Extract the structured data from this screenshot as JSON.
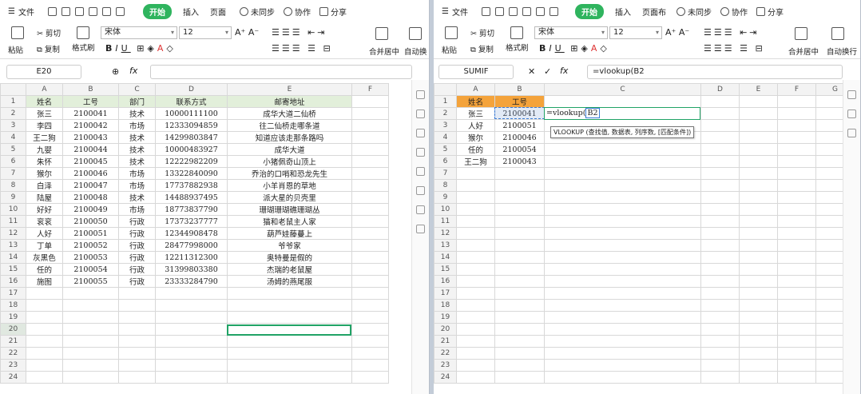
{
  "left": {
    "menu": {
      "hamburger": "☰",
      "file": "文件",
      "start": "开始",
      "insert": "插入",
      "page": "页面",
      "unsync": "未同步",
      "collab": "协作",
      "share": "分享"
    },
    "ribbon": {
      "paste": "粘贴",
      "cut": "剪切",
      "copy": "复制",
      "format_painter": "格式刷",
      "font": "宋体",
      "size": "12",
      "merge": "合并居中",
      "autowrap": "自动换"
    },
    "name_box": "E20",
    "fx": "fx",
    "formula": "",
    "columns": [
      "A",
      "B",
      "C",
      "D",
      "E",
      "F"
    ],
    "rows": [
      [
        "姓名",
        "工号",
        "部门",
        "联系方式",
        "邮寄地址",
        ""
      ],
      [
        "张三",
        "2100041",
        "技术",
        "10000111100",
        "成华大道二仙桥",
        ""
      ],
      [
        "李四",
        "2100042",
        "市场",
        "12333094859",
        "往二仙桥走哪条道",
        ""
      ],
      [
        "王二狗",
        "2100043",
        "技术",
        "14299803847",
        "知道应该走那条路吗",
        ""
      ],
      [
        "九婴",
        "2100044",
        "技术",
        "10000483927",
        "成华大道",
        ""
      ],
      [
        "朱怀",
        "2100045",
        "技术",
        "12222982209",
        "小猪佩奇山顶上",
        ""
      ],
      [
        "猴尔",
        "2100046",
        "市场",
        "13322840090",
        "乔治的口哨和恐龙先生",
        ""
      ],
      [
        "白泽",
        "2100047",
        "市场",
        "17737882938",
        "小羊肖恩的草地",
        ""
      ],
      [
        "陆屋",
        "2100048",
        "技术",
        "14488937495",
        "派大星的贝壳里",
        ""
      ],
      [
        "好好",
        "2100049",
        "市场",
        "18773837790",
        "珊瑚珊瑚礁珊瑚丛",
        ""
      ],
      [
        "衮衮",
        "2100050",
        "行政",
        "17373237777",
        "猫和老鼠主人家",
        ""
      ],
      [
        "人好",
        "2100051",
        "行政",
        "12344908478",
        "葫芦娃藤蔓上",
        ""
      ],
      [
        "丁单",
        "2100052",
        "行政",
        "28477998000",
        "爷爷家",
        ""
      ],
      [
        "灰黑色",
        "2100053",
        "行政",
        "12211312300",
        "奥特曼是假的",
        ""
      ],
      [
        "任的",
        "2100054",
        "行政",
        "31399803380",
        "杰瑞的老鼠屋",
        ""
      ],
      [
        "施图",
        "2100055",
        "行政",
        "23333284790",
        "汤姆的燕尾服",
        ""
      ],
      [
        "",
        "",
        "",
        "",
        "",
        ""
      ],
      [
        "",
        "",
        "",
        "",
        "",
        ""
      ],
      [
        "",
        "",
        "",
        "",
        "",
        ""
      ],
      [
        "",
        "",
        "",
        "",
        "",
        ""
      ],
      [
        "",
        "",
        "",
        "",
        "",
        ""
      ],
      [
        "",
        "",
        "",
        "",
        "",
        ""
      ],
      [
        "",
        "",
        "",
        "",
        "",
        ""
      ],
      [
        "",
        "",
        "",
        "",
        "",
        ""
      ]
    ]
  },
  "right": {
    "menu": {
      "hamburger": "☰",
      "file": "文件",
      "start": "开始",
      "insert": "插入",
      "page": "页面布",
      "unsync": "未同步",
      "collab": "协作",
      "share": "分享"
    },
    "ribbon": {
      "paste": "粘贴",
      "cut": "剪切",
      "copy": "复制",
      "format_painter": "格式刷",
      "font": "宋体",
      "size": "12",
      "merge": "合并居中",
      "autowrap": "自动换行"
    },
    "name_box": "SUMIF",
    "cancel": "✕",
    "confirm": "✓",
    "fx": "fx",
    "formula": "=vlookup(B2",
    "cell_edit_prefix": "=vlookup(",
    "cell_edit_ref": "B2",
    "tooltip": "VLOOKUP (查找值, 数据表, 列序数, [匹配条件])",
    "columns": [
      "A",
      "B",
      "C",
      "D",
      "E",
      "F",
      "G"
    ],
    "rows": [
      [
        "姓名",
        "工号",
        "",
        "",
        "",
        "",
        ""
      ],
      [
        "张三",
        "2100041",
        "",
        "",
        "",
        "",
        ""
      ],
      [
        "人好",
        "2100051",
        "",
        "",
        "",
        "",
        ""
      ],
      [
        "猴尔",
        "2100046",
        "",
        "",
        "",
        "",
        ""
      ],
      [
        "任的",
        "2100054",
        "",
        "",
        "",
        "",
        ""
      ],
      [
        "王二狗",
        "2100043",
        "",
        "",
        "",
        "",
        ""
      ],
      [
        "",
        "",
        "",
        "",
        "",
        "",
        ""
      ],
      [
        "",
        "",
        "",
        "",
        "",
        "",
        ""
      ],
      [
        "",
        "",
        "",
        "",
        "",
        "",
        ""
      ],
      [
        "",
        "",
        "",
        "",
        "",
        "",
        ""
      ],
      [
        "",
        "",
        "",
        "",
        "",
        "",
        ""
      ],
      [
        "",
        "",
        "",
        "",
        "",
        "",
        ""
      ],
      [
        "",
        "",
        "",
        "",
        "",
        "",
        ""
      ],
      [
        "",
        "",
        "",
        "",
        "",
        "",
        ""
      ],
      [
        "",
        "",
        "",
        "",
        "",
        "",
        ""
      ],
      [
        "",
        "",
        "",
        "",
        "",
        "",
        ""
      ],
      [
        "",
        "",
        "",
        "",
        "",
        "",
        ""
      ],
      [
        "",
        "",
        "",
        "",
        "",
        "",
        ""
      ],
      [
        "",
        "",
        "",
        "",
        "",
        "",
        ""
      ],
      [
        "",
        "",
        "",
        "",
        "",
        "",
        ""
      ],
      [
        "",
        "",
        "",
        "",
        "",
        "",
        ""
      ],
      [
        "",
        "",
        "",
        "",
        "",
        "",
        ""
      ],
      [
        "",
        "",
        "",
        "",
        "",
        "",
        ""
      ],
      [
        "",
        "",
        "",
        "",
        "",
        "",
        ""
      ]
    ]
  },
  "colors": {
    "green_pill": "#2fb45e",
    "header_green": "#e2efda",
    "header_orange": "#f4a33b",
    "select": "#21a366"
  }
}
